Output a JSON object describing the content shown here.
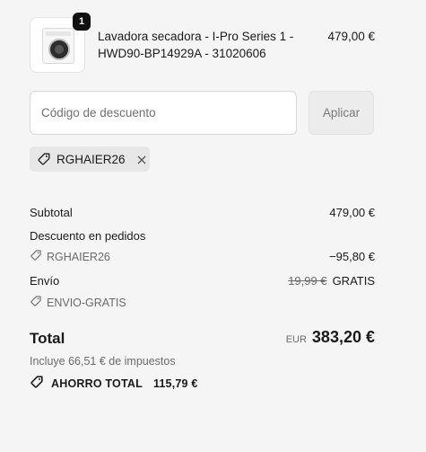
{
  "cart": {
    "item": {
      "quantity": "1",
      "name": "Lavadora secadora - I-Pro Series 1 - HWD90-BP14929A - 31020606",
      "price": "479,00 €",
      "thumbnail_icon": "washing-machine-image"
    }
  },
  "discount": {
    "placeholder": "Código de descuento",
    "value": "",
    "apply_label": "Aplicar",
    "applied_code": "RGHAIER26"
  },
  "summary": {
    "subtotal_label": "Subtotal",
    "subtotal_value": "479,00 €",
    "order_discount_label": "Descuento en pedidos",
    "order_discount_code": "RGHAIER26",
    "order_discount_value": "−95,80 €",
    "shipping_label": "Envío",
    "shipping_original": "19,99 €",
    "shipping_value": "GRATIS",
    "shipping_code": "ENVIO-GRATIS",
    "total_label": "Total",
    "currency": "EUR",
    "total_value": "383,20 €",
    "taxes_note": "Incluye 66,51 € de impuestos",
    "savings_label": "AHORRO TOTAL",
    "savings_value": "115,79 €"
  },
  "colors": {
    "background": "#f5f5f5",
    "text": "#1a1a1a",
    "muted": "#6b6b6b",
    "chip": "#e7e7e7"
  }
}
